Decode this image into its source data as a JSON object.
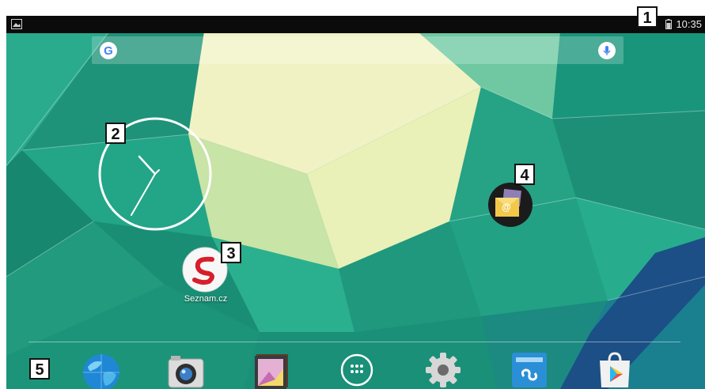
{
  "status_bar": {
    "time": "10:35",
    "left_icon": "screenshot-notification-icon",
    "right_icon": "battery-icon"
  },
  "search_bar": {
    "logo": "G",
    "mic_icon": "microphone-icon"
  },
  "clock_widget": {
    "hour_hand_time": "10:35",
    "style": "analog"
  },
  "apps": [
    {
      "label": "Seznam.cz",
      "icon": "seznam-app-icon"
    },
    {
      "label": "",
      "icon": "email-app-icon"
    }
  ],
  "dock": [
    {
      "icon": "browser-globe-icon"
    },
    {
      "icon": "camera-icon"
    },
    {
      "icon": "gallery-icon"
    },
    {
      "icon": "all-apps-icon"
    },
    {
      "icon": "settings-gear-icon"
    },
    {
      "icon": "file-manager-icon"
    },
    {
      "icon": "play-store-icon"
    }
  ],
  "callouts": [
    "1",
    "2",
    "3",
    "4",
    "5"
  ],
  "colors": {
    "wallpaper_teal": "#1f9a7f",
    "wallpaper_light": "#f2f1c0",
    "status_bar": "#0b0b0b",
    "google_blue": "#4285f4"
  }
}
